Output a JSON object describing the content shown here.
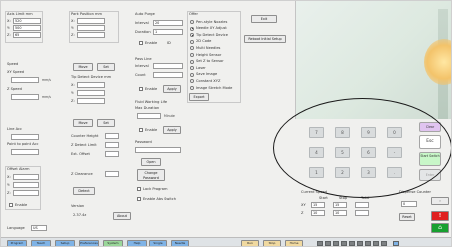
{
  "colors": {
    "esc_button": "#ffffff",
    "start_switch": "#c8f7c8",
    "alert_red": "#e02020",
    "ok_green": "#18a030",
    "clear_button": "#e0c4f0",
    "toolbar_blue": "#7fb3e6",
    "toolbar_yellow": "#f0d9a0",
    "toolbar_green": "#9ad79a"
  },
  "axis_length": {
    "title": "Axis Limit mm",
    "rows": [
      {
        "label": "X:",
        "value": "520"
      },
      {
        "label": "Y:",
        "value": "500"
      },
      {
        "label": "Z:",
        "value": "65"
      }
    ]
  },
  "park_position": {
    "title": "Park Position mm",
    "rows": [
      {
        "label": "X:",
        "value": ""
      },
      {
        "label": "Y:",
        "value": ""
      },
      {
        "label": "Z:",
        "value": ""
      }
    ]
  },
  "auto_purge": {
    "title": "Auto Purge",
    "interval_label": "Interval",
    "interval_value": "20",
    "duration_label": "Duration",
    "duration_value": "1",
    "enable_label": "Enable",
    "enable_suffix": "ID"
  },
  "offer": {
    "title": "Offer",
    "options": [
      {
        "label": "Pen-style Nozzles",
        "checked": false
      },
      {
        "label": "Needle XY Adjust",
        "checked": true
      },
      {
        "label": "Tip Detect Device",
        "checked": true
      },
      {
        "label": "2D Code",
        "checked": false
      },
      {
        "label": "Multi Needles",
        "checked": false
      },
      {
        "label": "Height Sensor",
        "checked": false
      },
      {
        "label": "Set Z to Sensor",
        "checked": false
      },
      {
        "label": "Laser",
        "checked": false
      },
      {
        "label": "Save Image",
        "checked": false
      },
      {
        "label": "Constant XYZ",
        "checked": false
      },
      {
        "label": "Image Stretch Mode",
        "checked": false
      }
    ],
    "export_label": "Export"
  },
  "exit_label": "Exit",
  "reboot_label": "Reboot Initial Setup",
  "speed": {
    "title": "Speed",
    "xy_label": "XY Speed",
    "xy_value": "",
    "xy_unit": "mm/s",
    "z_label": "Z Speed",
    "z_value": "",
    "z_unit": "mm/s"
  },
  "tip_detect": {
    "move_label": "Move",
    "set_label": "Set",
    "title": "Tip Detect Device mm",
    "rows": [
      {
        "label": "X:",
        "value": ""
      },
      {
        "label": "Y:",
        "value": ""
      },
      {
        "label": "Z:",
        "value": ""
      }
    ],
    "move2_label": "Move",
    "set2_label": "Set"
  },
  "pass_line": {
    "title": "Pass Line",
    "interval_label": "Interval",
    "interval_value": "",
    "count_label": "Count",
    "count_value": "",
    "enable_label": "Enable",
    "apply_label": "Apply"
  },
  "fluid_warning": {
    "title": "Fluid Working Life",
    "subtitle": "Max Duration",
    "value": "",
    "unit": "Minute",
    "enable_label": "Enable",
    "apply_label": "Apply"
  },
  "password": {
    "label": "Password",
    "value": "",
    "open_label": "Open",
    "change_label": "Change Password",
    "lock_label": "Lock Program",
    "enable_switch_label": "Enable Abs Switch"
  },
  "acc": {
    "line_label": "Line Acc",
    "line_value": "",
    "point_label": "Point to point Acc",
    "point_value": ""
  },
  "offset_alarm": {
    "title": "Offset Alarm",
    "rows": [
      {
        "label": "X:",
        "value": ""
      },
      {
        "label": "Y:",
        "value": ""
      },
      {
        "label": "Z:",
        "value": ""
      }
    ],
    "enable_label": "Enable"
  },
  "counter": {
    "counter_label": "Counter Height",
    "z_detect_label": "Z Detect Limit",
    "z_offset_label": "Ext. Offset",
    "clearance_label": "Z Clearance",
    "detect_label": "Detect"
  },
  "version": {
    "label": "Version",
    "value": "2.37.4z",
    "about_label": "About"
  },
  "language": {
    "label": "Language",
    "value": "US"
  },
  "keypad": {
    "rows": [
      [
        "7",
        "8",
        "9",
        "0"
      ],
      [
        "4",
        "5",
        "6",
        "-"
      ],
      [
        "1",
        "2",
        "3",
        "."
      ]
    ],
    "clear_label": "Clear",
    "esc_label": "Esc",
    "start_switch_label": "Start Switch",
    "enter_label": "Enter"
  },
  "bottom_panel": {
    "left_title": "Current Speed",
    "right_title": "Dispense Counter",
    "col_a": "Start",
    "col_b": "Stop",
    "col_c": "Total",
    "row_xy": "XY",
    "row_z": "Z",
    "xy_a": "15",
    "xy_b": "15",
    "z_a": "10",
    "z_b": "10",
    "count_value": "0",
    "reset_label": "Reset"
  },
  "toolbar": {
    "left_buttons": [
      "Program",
      "Teach",
      "Setup",
      "Preferences",
      "System",
      "Help"
    ],
    "mid_buttons": [
      "Single",
      "Needle"
    ],
    "right_buttons": [
      "Run",
      "Stop",
      "Home"
    ]
  },
  "side_buttons": {
    "home_glyph": "⌂",
    "alert_glyph": "!",
    "next_glyph": "›"
  }
}
